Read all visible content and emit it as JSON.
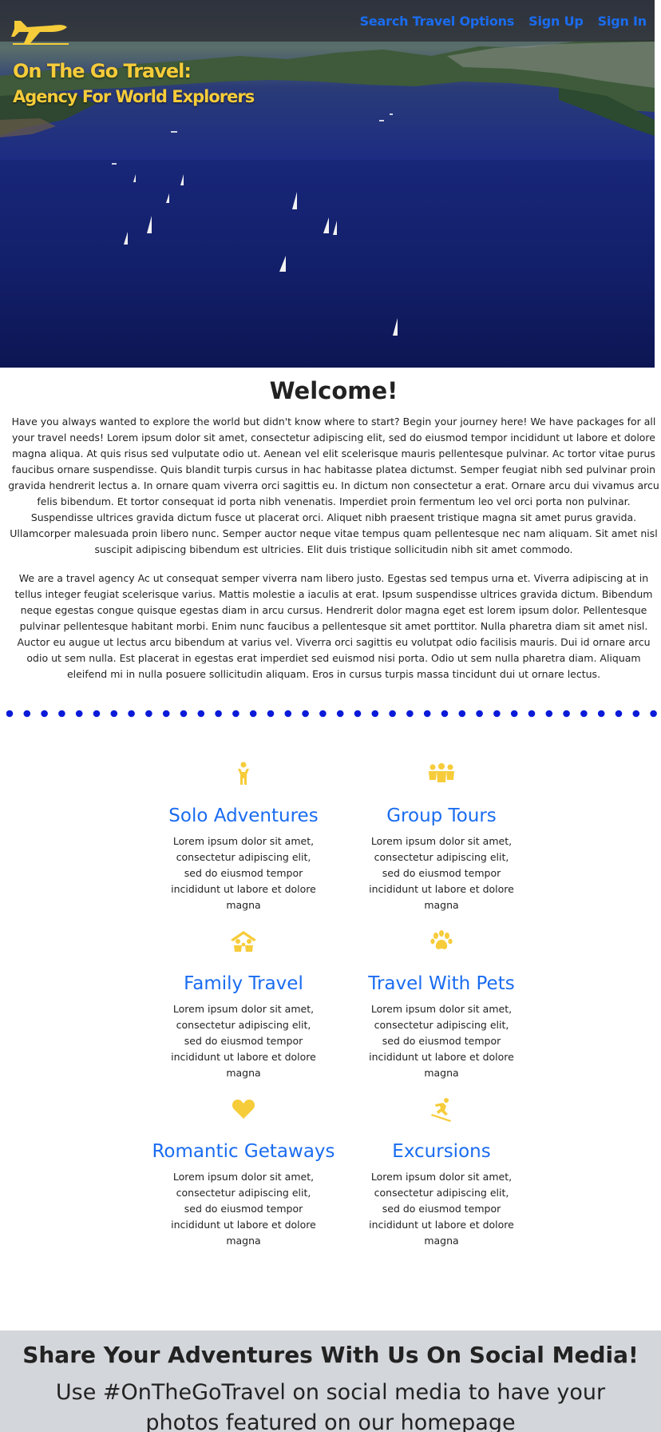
{
  "nav": {
    "links": [
      "Search Travel Options",
      "Sign Up",
      "Sign In"
    ]
  },
  "brand": {
    "line1": "On The Go Travel:",
    "line2": "Agency For World Explorers"
  },
  "welcome": {
    "heading": "Welcome!",
    "paragraph1": "Have you always wanted to explore the world but didn't know where to start? Begin your journey here! We have packages for all your travel needs! Lorem ipsum dolor sit amet, consectetur adipiscing elit, sed do eiusmod tempor incididunt ut labore et dolore magna aliqua. At quis risus sed vulputate odio ut. Aenean vel elit scelerisque mauris pellentesque pulvinar. Ac tortor vitae purus faucibus ornare suspendisse. Quis blandit turpis cursus in hac habitasse platea dictumst. Semper feugiat nibh sed pulvinar proin gravida hendrerit lectus a. In ornare quam viverra orci sagittis eu. In dictum non consectetur a erat. Ornare arcu dui vivamus arcu felis bibendum. Et tortor consequat id porta nibh venenatis. Imperdiet proin fermentum leo vel orci porta non pulvinar. Suspendisse ultrices gravida dictum fusce ut placerat orci. Aliquet nibh praesent tristique magna sit amet purus gravida. Ullamcorper malesuada proin libero nunc. Semper auctor neque vitae tempus quam pellentesque nec nam aliquam. Sit amet nisl suscipit adipiscing bibendum est ultricies. Elit duis tristique sollicitudin nibh sit amet commodo.",
    "paragraph2": "We are a travel agency Ac ut consequat semper viverra nam libero justo. Egestas sed tempus urna et. Viverra adipiscing at in tellus integer feugiat scelerisque varius. Mattis molestie a iaculis at erat. Ipsum suspendisse ultrices gravida dictum. Bibendum neque egestas congue quisque egestas diam in arcu cursus. Hendrerit dolor magna eget est lorem ipsum dolor. Pellentesque pulvinar pellentesque habitant morbi. Enim nunc faucibus a pellentesque sit amet porttitor. Nulla pharetra diam sit amet nisl. Auctor eu augue ut lectus arcu bibendum at varius vel. Viverra orci sagittis eu volutpat odio facilisis mauris. Dui id ornare arcu odio ut sem nulla. Est placerat in egestas erat imperdiet sed euismod nisi porta. Odio ut sem nulla pharetra diam. Aliquam eleifend mi in nulla posuere sollicitudin aliquam. Eros in cursus turpis massa tincidunt dui ut ornare lectus."
  },
  "features": [
    {
      "icon": "solo-traveler-icon",
      "title": "Solo Adventures",
      "text": "Lorem ipsum dolor sit amet, consectetur adipiscing elit, sed do eiusmod tempor incididunt ut labore et dolore magna"
    },
    {
      "icon": "group-icon",
      "title": "Group Tours",
      "text": "Lorem ipsum dolor sit amet, consectetur adipiscing elit, sed do eiusmod tempor incididunt ut labore et dolore magna"
    },
    {
      "icon": "family-home-icon",
      "title": "Family Travel",
      "text": "Lorem ipsum dolor sit amet, consectetur adipiscing elit, sed do eiusmod tempor incididunt ut labore et dolore magna"
    },
    {
      "icon": "paw-icon",
      "title": "Travel With Pets",
      "text": "Lorem ipsum dolor sit amet, consectetur adipiscing elit, sed do eiusmod tempor incididunt ut labore et dolore magna"
    },
    {
      "icon": "heart-icon",
      "title": "Romantic Getaways",
      "text": "Lorem ipsum dolor sit amet, consectetur adipiscing elit, sed do eiusmod tempor incididunt ut labore et dolore magna"
    },
    {
      "icon": "snowboarder-icon",
      "title": "Excursions",
      "text": "Lorem ipsum dolor sit amet, consectetur adipiscing elit, sed do eiusmod tempor incididunt ut labore et dolore magna"
    }
  ],
  "social": {
    "heading": "Share Your Adventures With Us On Social Media!",
    "text": "Use #OnTheGoTravel on social media to have your photos featured on our homepage"
  },
  "colors": {
    "accent_blue": "#1a6cf0",
    "brand_yellow": "#f6cc3a",
    "dot_blue": "#0a1ad8",
    "footer_gray": "#d3d6db"
  }
}
